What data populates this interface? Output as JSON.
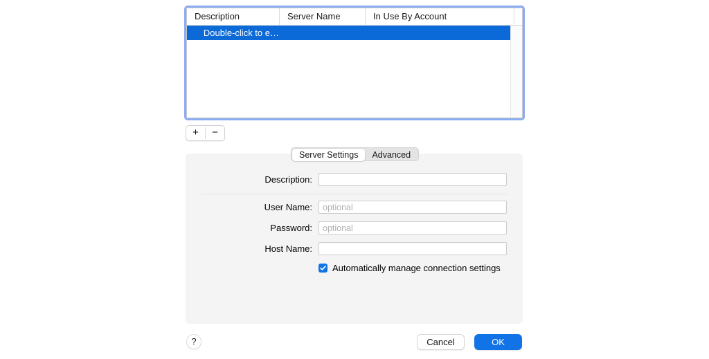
{
  "server_list": {
    "columns": [
      {
        "key": "description",
        "label": "Description"
      },
      {
        "key": "server_name",
        "label": "Server Name"
      },
      {
        "key": "in_use_by_account",
        "label": "In Use By Account"
      }
    ],
    "rows": [
      {
        "description": "Double-click to e…",
        "server_name": "",
        "in_use_by_account": "",
        "selected": true
      }
    ],
    "selection_color": "#0b6ad8",
    "focus_ring_color": "#8cadf2"
  },
  "list_controls": {
    "add_label": "+",
    "remove_label": "−"
  },
  "tabs": [
    {
      "label": "Server Settings",
      "active": true
    },
    {
      "label": "Advanced",
      "active": false
    }
  ],
  "form": {
    "description": {
      "label": "Description:",
      "value": "",
      "placeholder": ""
    },
    "user_name": {
      "label": "User Name:",
      "value": "",
      "placeholder": "optional"
    },
    "password": {
      "label": "Password:",
      "value": "",
      "placeholder": "optional"
    },
    "host_name": {
      "label": "Host Name:",
      "value": "",
      "placeholder": ""
    },
    "auto_manage": {
      "label": "Automatically manage connection settings",
      "checked": true,
      "color": "#1273e6"
    }
  },
  "footer": {
    "help_label": "?",
    "cancel_label": "Cancel",
    "ok_label": "OK",
    "ok_color": "#1273e6"
  }
}
